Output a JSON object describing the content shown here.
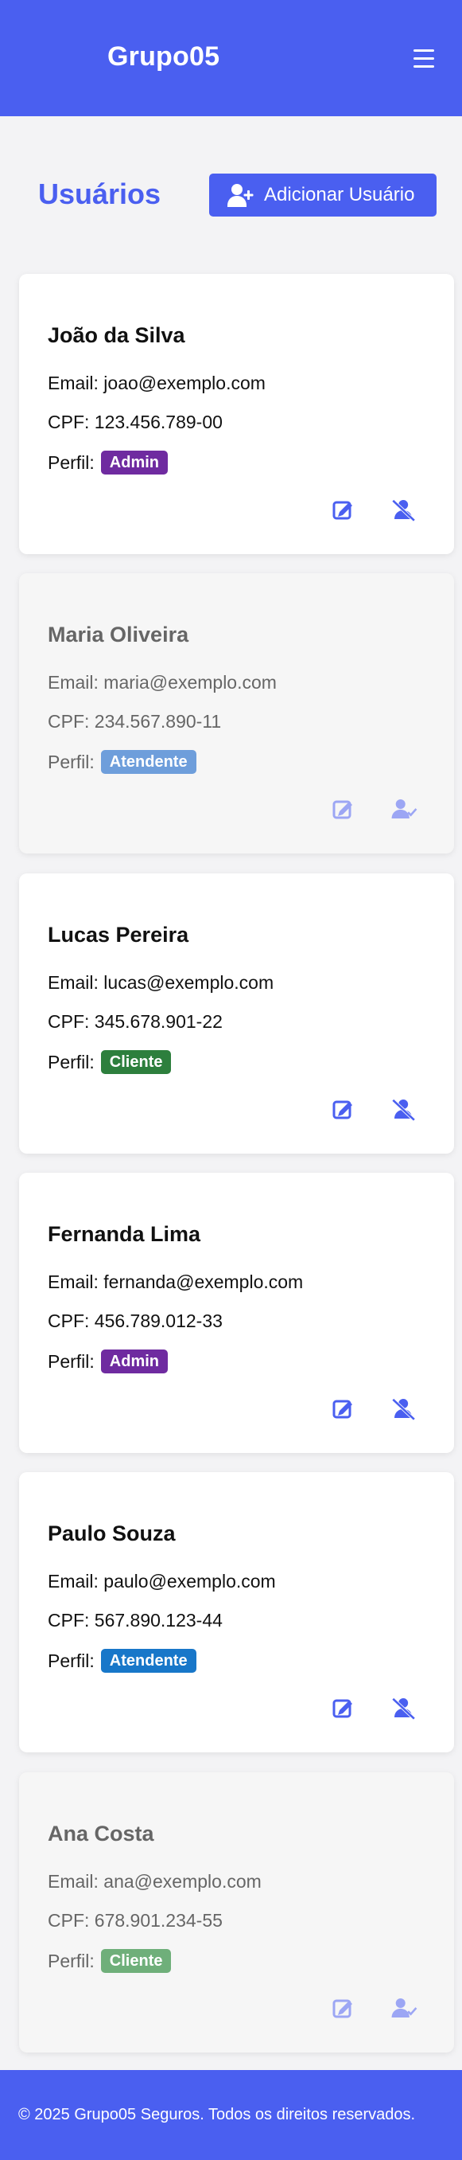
{
  "header": {
    "title": "Grupo05",
    "menu_icon": "hamburger-menu-icon"
  },
  "page": {
    "title": "Usuários",
    "add_button_label": "Adicionar Usuário",
    "add_button_icon": "user-plus-icon"
  },
  "labels": {
    "email_prefix": "Email:",
    "cpf_prefix": "CPF:",
    "role_prefix": "Perfil:"
  },
  "users": [
    {
      "name": "João da Silva",
      "email": "joao@exemplo.com",
      "cpf": "123.456.789-00",
      "role": "Admin",
      "role_color": "#6f2ba0",
      "active": true,
      "status_icon": "user-deactivate-icon"
    },
    {
      "name": "Maria Oliveira",
      "email": "maria@exemplo.com",
      "cpf": "234.567.890-11",
      "role": "Atendente",
      "role_color": "#6e9edb",
      "active": false,
      "status_icon": "user-check-icon"
    },
    {
      "name": "Lucas Pereira",
      "email": "lucas@exemplo.com",
      "cpf": "345.678.901-22",
      "role": "Cliente",
      "role_color": "#2d7f3d",
      "active": true,
      "status_icon": "user-deactivate-icon"
    },
    {
      "name": "Fernanda Lima",
      "email": "fernanda@exemplo.com",
      "cpf": "456.789.012-33",
      "role": "Admin",
      "role_color": "#6f2ba0",
      "active": true,
      "status_icon": "user-deactivate-icon"
    },
    {
      "name": "Paulo Souza",
      "email": "paulo@exemplo.com",
      "cpf": "567.890.123-44",
      "role": "Atendente",
      "role_color": "#1877c9",
      "active": true,
      "status_icon": "user-deactivate-icon"
    },
    {
      "name": "Ana Costa",
      "email": "ana@exemplo.com",
      "cpf": "678.901.234-55",
      "role": "Cliente",
      "role_color": "#6faf7a",
      "active": false,
      "status_icon": "user-check-icon"
    }
  ],
  "footer": {
    "text": "© 2025 Grupo05 Seguros. Todos os direitos reservados."
  },
  "colors": {
    "primary": "#4a5ff0",
    "icon": "#4a5ff0",
    "muted_icon": "#7a88f4"
  }
}
